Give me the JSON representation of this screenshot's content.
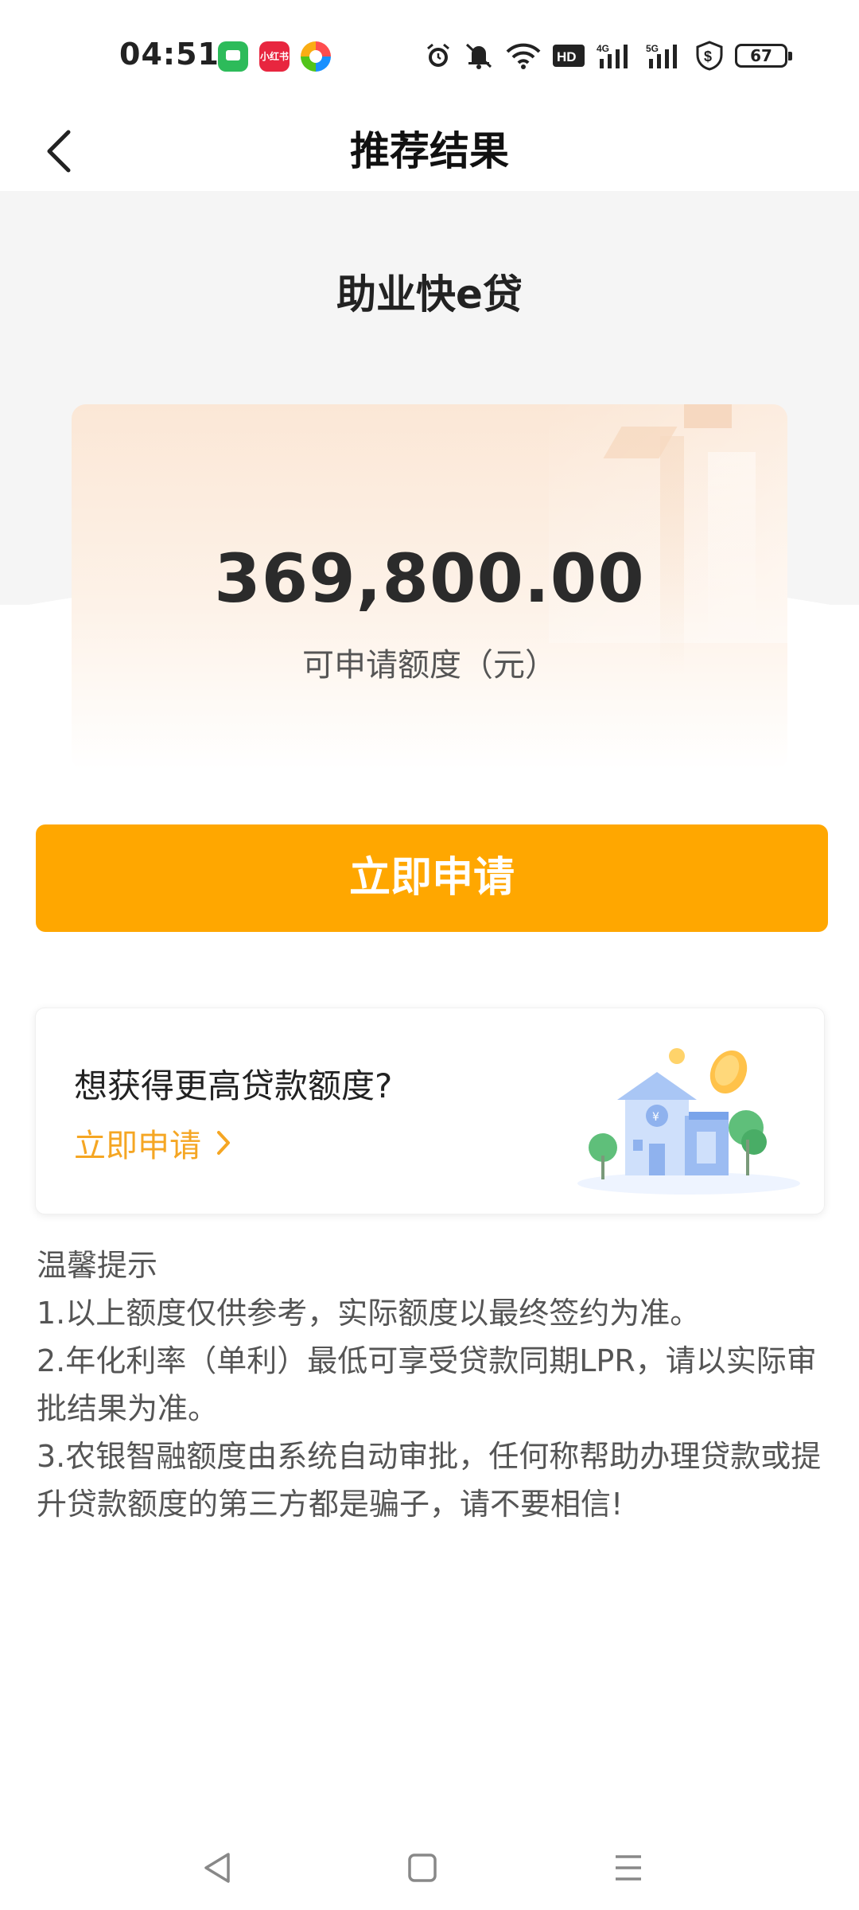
{
  "status_bar": {
    "time": "04:51",
    "app_red_label": "小红书",
    "battery": "67",
    "icons": [
      "alarm-icon",
      "silent-icon",
      "wifi-icon",
      "hd-icon",
      "signal-4g-icon",
      "signal-5g-icon",
      "shield-dollar-icon",
      "battery-icon"
    ]
  },
  "header": {
    "title": "推荐结果"
  },
  "product": {
    "name": "助业快e贷"
  },
  "amount_card": {
    "amount": "369,800.00",
    "label": "可申请额度（元）"
  },
  "apply_button": {
    "label": "立即申请"
  },
  "promo": {
    "title": "想获得更高贷款额度?",
    "link_label": "立即申请"
  },
  "tips": {
    "title": "温馨提示",
    "items": [
      "1.以上额度仅供参考，实际额度以最终签约为准。",
      "2.年化利率（单利）最低可享受贷款同期LPR，请以实际审批结果为准。",
      "3.农银智融额度由系统自动审批，任何称帮助办理贷款或提升贷款额度的第三方都是骗子，请不要相信!"
    ]
  },
  "colors": {
    "accent": "#ffa700",
    "link": "#f5a623",
    "hero_bg": "#f5f5f5"
  }
}
